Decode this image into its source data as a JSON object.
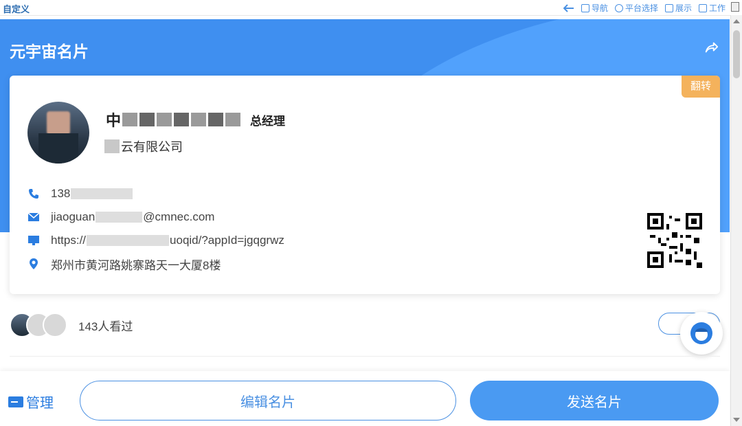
{
  "topbar": {
    "title": "自定义",
    "tools": [
      {
        "label": "导航",
        "icon": "nav-icon"
      },
      {
        "label": "平台选择",
        "icon": "refresh-icon"
      },
      {
        "label": "展示",
        "icon": "display-icon"
      },
      {
        "label": "工作",
        "icon": "edit-icon"
      }
    ]
  },
  "header": {
    "title": "元宇宙名片",
    "share_icon": "share-icon",
    "bg_color": "#3f8ff0"
  },
  "card": {
    "flip_label": "翻转",
    "name_visible": "中",
    "role": "总经理",
    "company_visible": "云有限公司",
    "contacts": [
      {
        "icon": "phone-icon",
        "text": "138"
      },
      {
        "icon": "mail-icon",
        "text_prefix": "jiaoguan",
        "text_suffix": "@cmnec.com"
      },
      {
        "icon": "monitor-icon",
        "text_prefix": "https://",
        "text_suffix": "uoqid/?appId=jgqgrwz"
      },
      {
        "icon": "location-icon",
        "text": "郑州市黄河路姚寨路天一大厦8楼"
      }
    ],
    "qr_icon": "qr-code-icon"
  },
  "viewers": {
    "count_text": "143人看过"
  },
  "bottom": {
    "manage_label": "管理",
    "edit_label": "编辑名片",
    "send_label": "发送名片"
  },
  "colors": {
    "primary": "#4a9af2",
    "accent": "#f4b25c"
  }
}
